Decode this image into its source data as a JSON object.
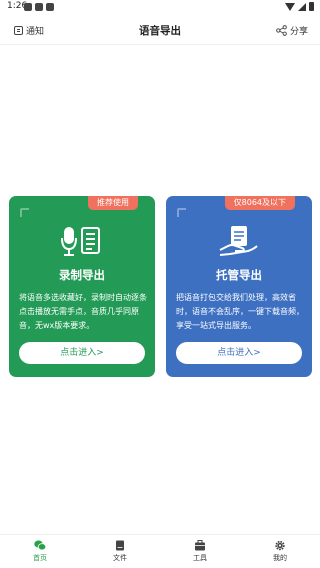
{
  "status_bar": {
    "time": "1:26"
  },
  "header": {
    "notify_label": "通知",
    "title": "语音导出",
    "share_label": "分享"
  },
  "cards": [
    {
      "badge": "推荐使用",
      "title": "录制导出",
      "description": "将语音多选收藏好，录制时自动逐条点击播放无需手点，音质几乎同原音，无wx版本要求。",
      "button_label": "点击进入>",
      "icon": "microphone-document-icon",
      "color": "#239b56"
    },
    {
      "badge": "仅8064及以下",
      "title": "托管导出",
      "description": "把语音打包交给我们处理，高效省时，语音不会乱序，一键下载音频，享受一站式导出服务。",
      "button_label": "点击进入>",
      "icon": "hand-document-icon",
      "color": "#3e70c2"
    }
  ],
  "bottom_nav": {
    "items": [
      {
        "label": "首页",
        "icon": "home-chat-icon",
        "active": true
      },
      {
        "label": "文件",
        "icon": "file-icon",
        "active": false
      },
      {
        "label": "工具",
        "icon": "toolbox-icon",
        "active": false
      },
      {
        "label": "我的",
        "icon": "gear-icon",
        "active": false
      }
    ],
    "active_color": "#27a14a"
  }
}
